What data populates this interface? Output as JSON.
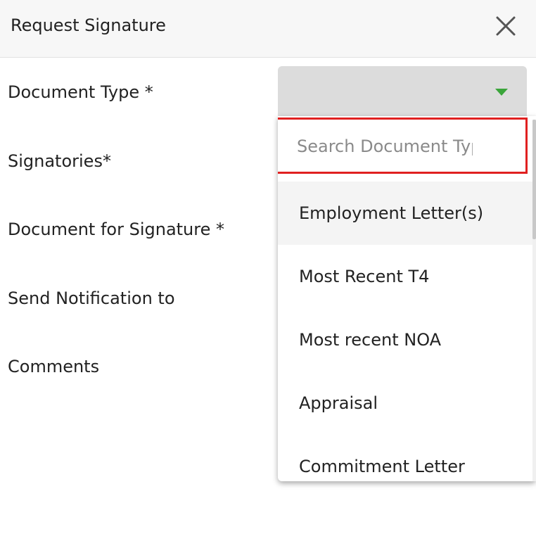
{
  "header": {
    "title": "Request Signature",
    "close_icon": "close-icon"
  },
  "form": {
    "labels": [
      "Document Type *",
      "Signatories*",
      "Document for Signature *",
      "Send Notification to",
      "Comments"
    ],
    "document_type": {
      "value": "",
      "caret_color": "#3aa53a"
    }
  },
  "dropdown": {
    "search_placeholder": "Search Document Type",
    "highlight_color": "#e02020",
    "options": [
      "Employment Letter(s)",
      "Most Recent T4",
      "Most recent NOA",
      "Appraisal",
      "Commitment Letter"
    ],
    "active_option": "Employment Letter(s)"
  }
}
